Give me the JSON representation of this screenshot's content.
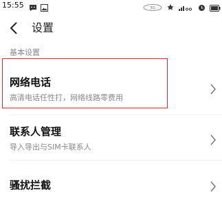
{
  "status_bar": {
    "time": "15:55",
    "signal_text": "ııl",
    "icons": [
      "chat-bubble-icon",
      "image-icon",
      "carrier-badge-icon",
      "network-icon",
      "signal-icon",
      "alarm-icon",
      "battery-icon"
    ]
  },
  "nav": {
    "back_icon": "chevron-left-icon",
    "title": "设置"
  },
  "section": {
    "header": "基本设置"
  },
  "rows": [
    {
      "title": "网络电话",
      "subtitle": "高清电话任性打，网络线路零费用"
    },
    {
      "title": "联系人管理",
      "subtitle": "导入导出与SIM卡联系人"
    },
    {
      "title": "骚扰拦截",
      "subtitle": ""
    }
  ],
  "colors": {
    "highlight": "#d62b2b",
    "subtitle": "#8a8a8a",
    "section_header": "#888888"
  }
}
